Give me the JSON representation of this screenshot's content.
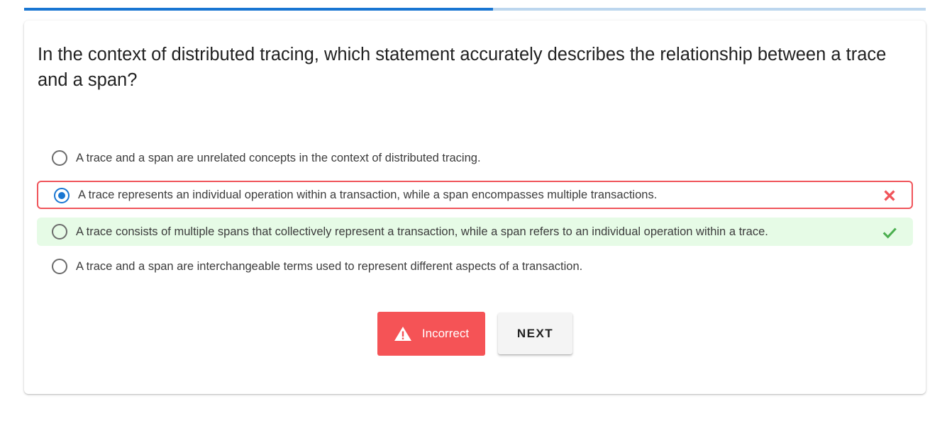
{
  "progress": {
    "fraction": 0.52
  },
  "quiz": {
    "question": "In the context of distributed tracing, which statement accurately describes the relationship between a trace and a span?",
    "options": [
      {
        "text": "A trace and a span are unrelated concepts in the context of distributed tracing.",
        "selected": false,
        "state": "neutral"
      },
      {
        "text": "A trace represents an individual operation within a transaction, while a span encompasses multiple transactions.",
        "selected": true,
        "state": "incorrect"
      },
      {
        "text": "A trace consists of multiple spans that collectively represent a transaction, while a span refers to an individual operation within a trace.",
        "selected": false,
        "state": "correct"
      },
      {
        "text": "A trace and a span are interchangeable terms used to represent different aspects of a transaction.",
        "selected": false,
        "state": "neutral"
      }
    ]
  },
  "actions": {
    "result_label": "Incorrect",
    "result_icon": "warning-icon",
    "next_label": "NEXT"
  },
  "colors": {
    "accent": "#1976d2",
    "error": "#f55356",
    "success": "#4caf50",
    "success_bg": "#e6fbe6"
  },
  "icons": {
    "incorrect_mark": "close-icon",
    "correct_mark": "check-icon"
  }
}
